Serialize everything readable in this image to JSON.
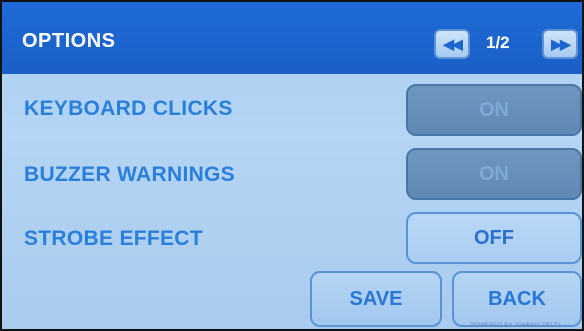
{
  "header": {
    "title": "OPTIONS",
    "page_indicator": "1/2",
    "prev_icon": "double-left-arrow-icon",
    "next_icon": "double-right-arrow-icon"
  },
  "settings": [
    {
      "label": "KEYBOARD CLICKS",
      "value": "ON"
    },
    {
      "label": "BUZZER WARNINGS",
      "value": "ON"
    },
    {
      "label": "STROBE EFFECT",
      "value": "OFF"
    }
  ],
  "actions": {
    "save_label": "SAVE",
    "back_label": "BACK"
  },
  "footer": {
    "text": "POWERED BY JOHNNY DELTA"
  },
  "colors": {
    "header_bg": "#1f6bd6",
    "screen_bg": "#aacdf1",
    "label_text": "#2a7fdc",
    "toggle_on_bg": "#6e97bf",
    "toggle_off_bg": "#b9d8f6"
  }
}
